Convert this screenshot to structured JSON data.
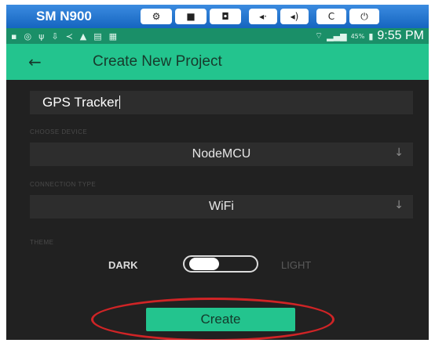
{
  "emulator": {
    "device_name": "SM N900",
    "buttons": [
      {
        "icon": "gear-icon",
        "glyph": "⚙"
      },
      {
        "icon": "video-icon",
        "glyph": "■"
      },
      {
        "icon": "camera-icon",
        "glyph": "◘"
      },
      {
        "icon": "volume-down-icon",
        "glyph": "◂·"
      },
      {
        "icon": "volume-up-icon",
        "glyph": "◂)"
      },
      {
        "icon": "rotate-icon",
        "glyph": "C"
      },
      {
        "icon": "power-icon",
        "glyph": "⏻"
      }
    ]
  },
  "status_bar": {
    "battery_percent": "45%",
    "time": "9:55 PM"
  },
  "app_bar": {
    "back_glyph": "←",
    "title": "Create New Project"
  },
  "form": {
    "project_name": "GPS Tracker",
    "device_label": "CHOOSE DEVICE",
    "device_value": "NodeMCU",
    "connection_label": "CONNECTION TYPE",
    "connection_value": "WiFi",
    "dropdown_glyph": "↓",
    "theme_label": "THEME",
    "theme_dark": "DARK",
    "theme_light": "LIGHT",
    "theme_selected": "DARK"
  },
  "create_button": {
    "label": "Create"
  },
  "colors": {
    "accent": "#23c48e",
    "background": "#212121",
    "annotation": "#d02426",
    "emulator_bar": "#1565c0"
  }
}
